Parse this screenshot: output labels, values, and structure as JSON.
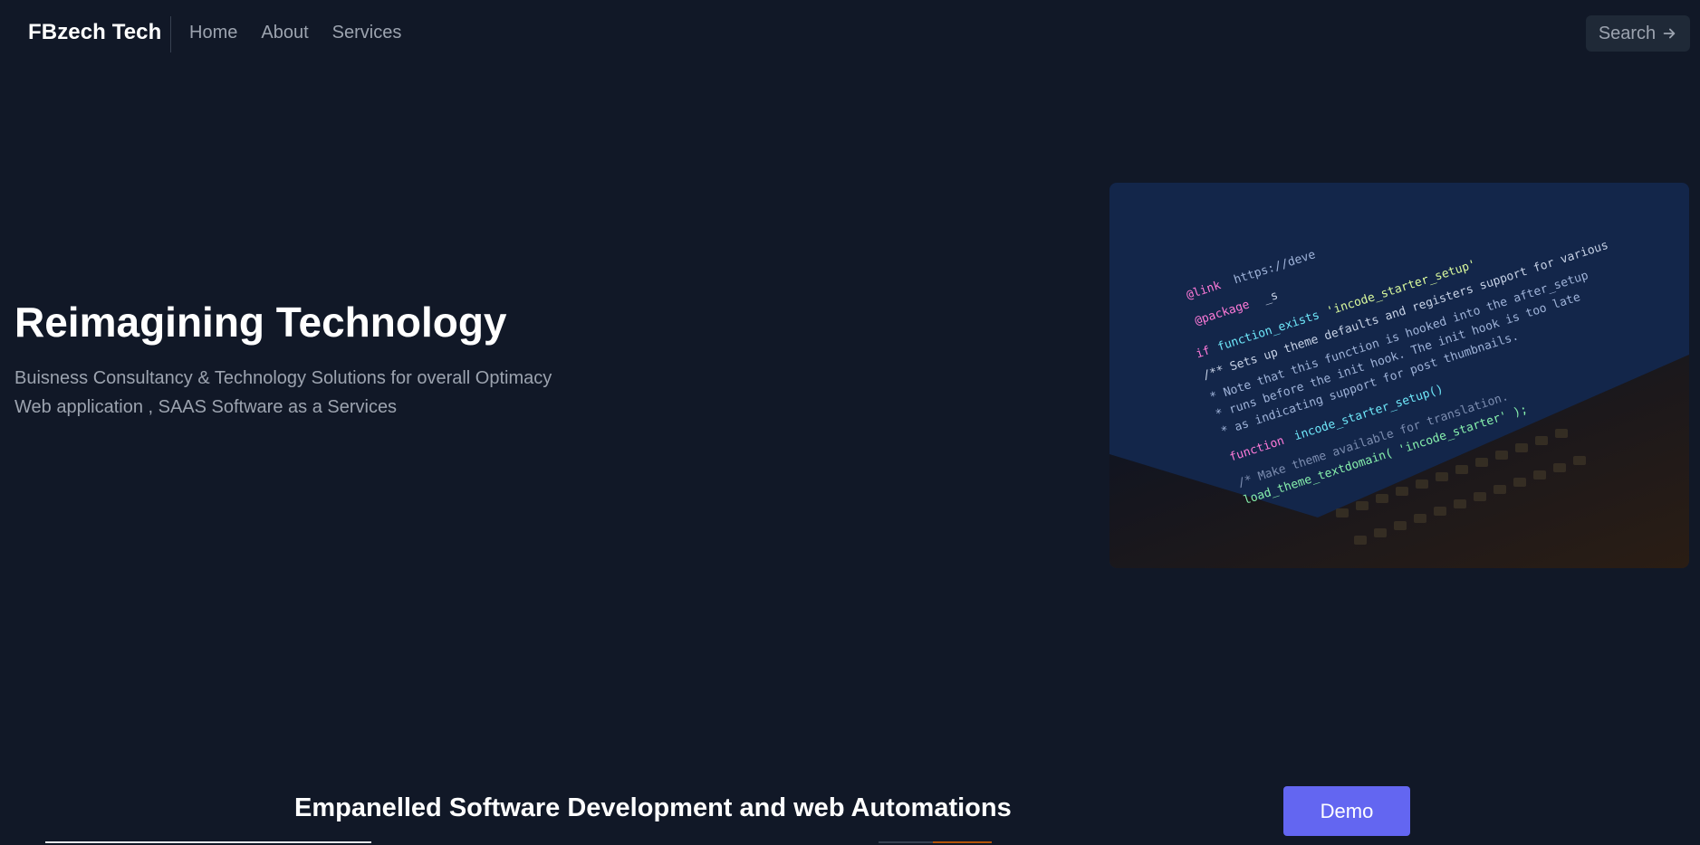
{
  "header": {
    "brand": "FBzech Tech",
    "nav": [
      {
        "label": "Home"
      },
      {
        "label": "About"
      },
      {
        "label": "Services"
      }
    ],
    "search_label": "Search"
  },
  "hero": {
    "title": "Reimagining Technology",
    "subtitle_line1": "Buisness Consultancy & Technology Solutions for overall Optimacy",
    "subtitle_line2": "Web application , SAAS Software as a Services"
  },
  "section": {
    "title": "Empanelled Software Development and web Automations",
    "demo_label": "Demo"
  },
  "colors": {
    "background": "#111827",
    "accent": "#6366f1",
    "muted_text": "#9ca3af"
  },
  "icons": {
    "search_arrow": "arrow-right-icon"
  }
}
